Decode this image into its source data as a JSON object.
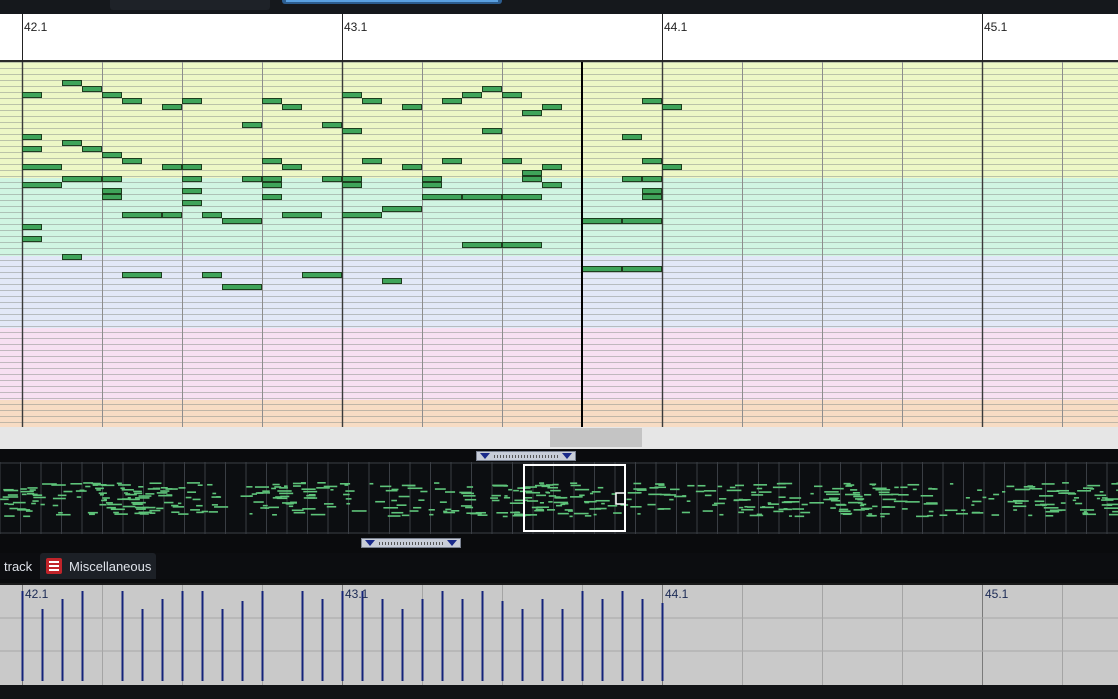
{
  "ruler": {
    "labels": [
      "42.1",
      "43.1",
      "44.1",
      "45.1"
    ]
  },
  "velocity_ruler": {
    "labels": [
      "42.1",
      "43.1",
      "44.1",
      "45.1"
    ]
  },
  "trackbar": {
    "track_label": "track",
    "misc_label": "Miscellaneous"
  },
  "piano_roll": {
    "playhead_beat": 7.0,
    "notes": [
      [
        0,
        5,
        0.5
      ],
      [
        0,
        12,
        0.5
      ],
      [
        0,
        14,
        0.5
      ],
      [
        0,
        17,
        1.0
      ],
      [
        0,
        20,
        1.0
      ],
      [
        0,
        27,
        0.5
      ],
      [
        0,
        29,
        0.5
      ],
      [
        1,
        3,
        0.5
      ],
      [
        1,
        13,
        0.5
      ],
      [
        1,
        19,
        1.0
      ],
      [
        1,
        32,
        0.5
      ],
      [
        1.5,
        4,
        0.5
      ],
      [
        1.5,
        14,
        0.5
      ],
      [
        2,
        5,
        0.5
      ],
      [
        2,
        15,
        0.5
      ],
      [
        2,
        19,
        0.5
      ],
      [
        2,
        21,
        0.5
      ],
      [
        2,
        22,
        0.5
      ],
      [
        2.5,
        6,
        0.5
      ],
      [
        2.5,
        16,
        0.5
      ],
      [
        2.5,
        25,
        1.0
      ],
      [
        2.5,
        35,
        1.0
      ],
      [
        3.5,
        7,
        0.5
      ],
      [
        3.5,
        17,
        0.5
      ],
      [
        3.5,
        25,
        0.5
      ],
      [
        4,
        6,
        0.5
      ],
      [
        4,
        17,
        0.5
      ],
      [
        4,
        19,
        0.5
      ],
      [
        4,
        21,
        0.5
      ],
      [
        4,
        23,
        0.5
      ],
      [
        4.5,
        25,
        0.5
      ],
      [
        4.5,
        35,
        0.5
      ],
      [
        5,
        26,
        1.0
      ],
      [
        5,
        37,
        1.0
      ],
      [
        5.5,
        10,
        0.5
      ],
      [
        5.5,
        19,
        0.5
      ],
      [
        6,
        6,
        0.5
      ],
      [
        6,
        16,
        0.5
      ],
      [
        6,
        19,
        0.5
      ],
      [
        6,
        20,
        0.5
      ],
      [
        6,
        22,
        0.5
      ],
      [
        6.5,
        7,
        0.5
      ],
      [
        6.5,
        17,
        0.5
      ],
      [
        6.5,
        25,
        1.0
      ],
      [
        7,
        35,
        1.0
      ],
      [
        7.5,
        10,
        0.5
      ],
      [
        7.5,
        19,
        0.5
      ],
      [
        8,
        5,
        0.5
      ],
      [
        8,
        11,
        0.5
      ],
      [
        8,
        19,
        0.5
      ],
      [
        8,
        20,
        0.5
      ],
      [
        8,
        25,
        1.0
      ],
      [
        8.5,
        6,
        0.5
      ],
      [
        8.5,
        16,
        0.5
      ],
      [
        9,
        24,
        1.0
      ],
      [
        9,
        36,
        0.5
      ],
      [
        9.5,
        7,
        0.5
      ],
      [
        9.5,
        17,
        0.5
      ],
      [
        10,
        19,
        0.5
      ],
      [
        10,
        20,
        0.5
      ],
      [
        10,
        22,
        1.0
      ],
      [
        10.5,
        6,
        0.5
      ],
      [
        10.5,
        16,
        0.5
      ],
      [
        11,
        5,
        0.5
      ],
      [
        11,
        22,
        1.0
      ],
      [
        11,
        30,
        1.0
      ],
      [
        11.5,
        4,
        0.5
      ],
      [
        11.5,
        11,
        0.5
      ],
      [
        12,
        5,
        0.5
      ],
      [
        12,
        16,
        0.5
      ],
      [
        12,
        22,
        1.0
      ],
      [
        12,
        30,
        1.0
      ],
      [
        12.5,
        8,
        0.5
      ],
      [
        12.5,
        18,
        0.5
      ],
      [
        12.5,
        19,
        0.5
      ],
      [
        13,
        7,
        0.5
      ],
      [
        13,
        17,
        0.5
      ],
      [
        13,
        20,
        0.5
      ],
      [
        14,
        26,
        1.0
      ],
      [
        14,
        34,
        1.0
      ],
      [
        15,
        12,
        0.5
      ],
      [
        15,
        19,
        0.5
      ],
      [
        15,
        26,
        1.0
      ],
      [
        15,
        34,
        1.0
      ],
      [
        15.5,
        6,
        0.5
      ],
      [
        15.5,
        16,
        0.5
      ],
      [
        15.5,
        19,
        0.5
      ],
      [
        15.5,
        21,
        0.5
      ],
      [
        15.5,
        22,
        0.5
      ],
      [
        16,
        7,
        0.5
      ],
      [
        16,
        17,
        0.5
      ]
    ]
  },
  "velocities": [
    [
      0,
      90
    ],
    [
      0.5,
      72
    ],
    [
      1,
      82
    ],
    [
      1.5,
      90
    ],
    [
      2.5,
      90
    ],
    [
      3,
      72
    ],
    [
      3.5,
      82
    ],
    [
      4,
      90
    ],
    [
      4.5,
      90
    ],
    [
      5,
      72
    ],
    [
      5.5,
      80
    ],
    [
      6,
      90
    ],
    [
      7,
      90
    ],
    [
      7.5,
      82
    ],
    [
      8,
      90
    ],
    [
      8.5,
      90
    ],
    [
      9,
      82
    ],
    [
      9.5,
      72
    ],
    [
      10,
      82
    ],
    [
      10.5,
      90
    ],
    [
      11,
      82
    ],
    [
      11.5,
      90
    ],
    [
      12,
      80
    ],
    [
      12.5,
      72
    ],
    [
      13,
      82
    ],
    [
      13.5,
      72
    ],
    [
      14,
      90
    ],
    [
      14.5,
      82
    ],
    [
      15,
      90
    ],
    [
      15.5,
      82
    ],
    [
      16,
      78
    ]
  ]
}
